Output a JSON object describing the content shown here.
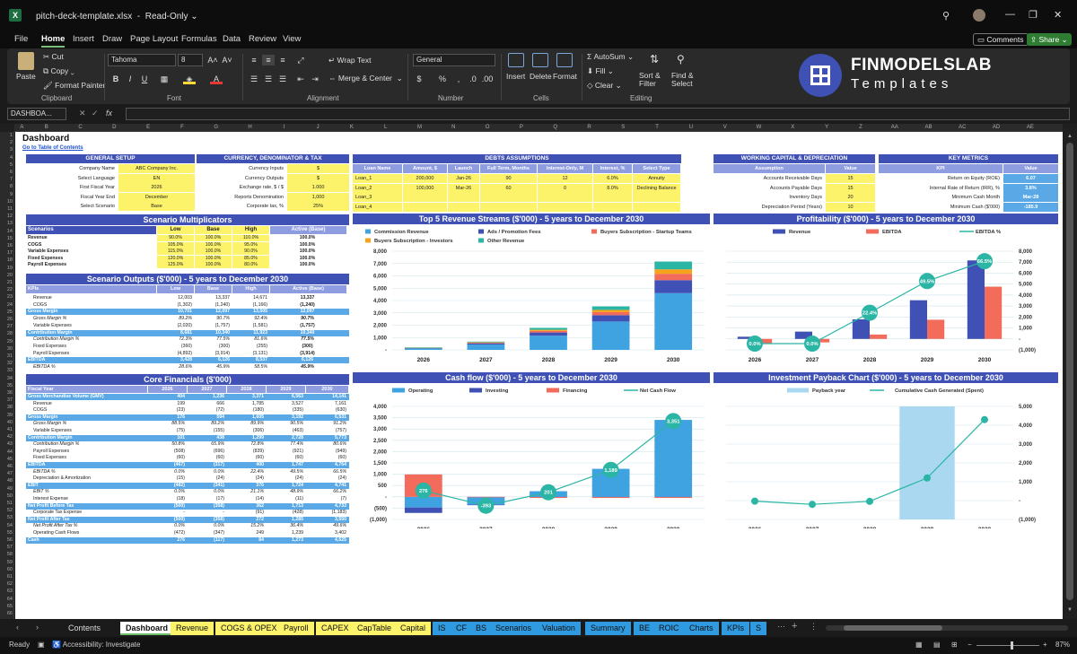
{
  "app": {
    "filename": "pitch-deck-template.xlsx",
    "mode": "Read-Only"
  },
  "menu": {
    "items": [
      "File",
      "Home",
      "Insert",
      "Draw",
      "Page Layout",
      "Formulas",
      "Data",
      "Review",
      "View"
    ],
    "active": "Home",
    "comments": "Comments",
    "share": "Share"
  },
  "ribbon": {
    "paste": "Paste",
    "cut": "Cut",
    "copy": "Copy",
    "format_painter": "Format Painter",
    "clipboard": "Clipboard",
    "font_name": "Tahoma",
    "font_size": "8",
    "font_group": "Font",
    "wrap_text": "Wrap Text",
    "merge_center": "Merge & Center",
    "alignment": "Alignment",
    "number_format": "General",
    "number_group": "Number",
    "insert": "Insert",
    "delete": "Delete",
    "format": "Format",
    "cells": "Cells",
    "autosum": "AutoSum",
    "fill": "Fill",
    "clear": "Clear",
    "sort_filter": "Sort & Filter",
    "find_select": "Find & Select",
    "editing": "Editing"
  },
  "brand": {
    "name": "FINMODELSLAB",
    "tagline": "Templates",
    "accent": "#3f51b5"
  },
  "formula_bar": {
    "namebox": "DASHBOA...",
    "fx": "fx"
  },
  "columns": [
    "A",
    "B",
    "C",
    "D",
    "E",
    "F",
    "G",
    "H",
    "I",
    "J",
    "K",
    "L",
    "M",
    "N",
    "O",
    "P",
    "Q",
    "R",
    "S",
    "T",
    "U",
    "V",
    "W",
    "X",
    "Y",
    "Z",
    "AA",
    "AB",
    "AC",
    "AD",
    "AE"
  ],
  "sheet": {
    "title": "Dashboard",
    "toc_link": "Go to Table of Contents",
    "general": {
      "title": "GENERAL SETUP",
      "rows": [
        [
          "Company Name",
          "ABC Company Inc."
        ],
        [
          "Select Language",
          "EN"
        ],
        [
          "First Fiscal Year",
          "2026"
        ],
        [
          "Fiscal Year End",
          "December"
        ],
        [
          "Select Scenario",
          "Base"
        ]
      ]
    },
    "currency": {
      "title": "CURRENCY, DENOMINATOR & TAX",
      "rows": [
        [
          "Currency Inputs",
          "$"
        ],
        [
          "Currency Outputs",
          "$"
        ],
        [
          "Exchange rate, $ / $",
          "1.000"
        ],
        [
          "Reports Denomination",
          "1,000"
        ],
        [
          "Corporate tax, %",
          "25%"
        ]
      ]
    },
    "debts": {
      "title": "DEBTS ASSUMPTIONS",
      "headers": [
        "Loan Name",
        "Amount, $",
        "Launch",
        "Full Term, Months",
        "Interest-Only, M",
        "Interest, %",
        "Select Type"
      ],
      "rows": [
        [
          "Loan_1",
          "200,000",
          "Jan-26",
          "90",
          "12",
          "6.0%",
          "Annuity"
        ],
        [
          "Loan_2",
          "100,000",
          "Mar-26",
          "60",
          "0",
          "8.0%",
          "Declining Balance"
        ],
        [
          "Loan_3",
          "",
          "",
          "",
          "",
          "",
          ""
        ],
        [
          "Loan_4",
          "",
          "",
          "",
          "",
          "",
          ""
        ]
      ]
    },
    "working": {
      "title": "WORKING CAPITAL & DEPRECIATION",
      "headers": [
        "Assumption",
        "Value"
      ],
      "rows": [
        [
          "Accounts Receivable Days",
          "15"
        ],
        [
          "Accounts Payable Days",
          "15"
        ],
        [
          "Inventory Days",
          "20"
        ],
        [
          "Depreciation Period (Years)",
          "10"
        ]
      ]
    },
    "kpis": {
      "title": "KEY METRICS",
      "headers": [
        "KPI",
        "Value"
      ],
      "rows": [
        [
          "Return on Equity (ROE)",
          "6.07"
        ],
        [
          "Internal Rate of Return (IRR), %",
          "3.8%"
        ],
        [
          "Minimum Cash Month",
          "Mar-28"
        ],
        [
          "Minimum Cash ($'000)",
          "-185.9"
        ]
      ]
    },
    "multipliers": {
      "title": "Scenario Multiplicators",
      "headers": [
        "Scenarios",
        "Low",
        "Base",
        "High",
        "Active (Base)"
      ],
      "rows": [
        [
          "Revenue",
          "90.0%",
          "100.0%",
          "110.0%",
          "100.0%"
        ],
        [
          "COGS",
          "105.0%",
          "100.0%",
          "95.0%",
          "100.0%"
        ],
        [
          "Variable Expenses",
          "115.0%",
          "100.0%",
          "90.0%",
          "100.0%"
        ],
        [
          "Fixed Expenses",
          "120.0%",
          "100.0%",
          "85.0%",
          "100.0%"
        ],
        [
          "Payroll Expenses",
          "125.0%",
          "100.0%",
          "80.0%",
          "100.0%"
        ]
      ]
    },
    "scen_out": {
      "title": "Scenario Outputs ($'000) - 5 years to December 2030",
      "headers": [
        "KPIs",
        "Low",
        "Base",
        "High",
        "Active (Base)"
      ],
      "rows": [
        [
          "Revenue",
          "12,003",
          "13,337",
          "14,671",
          "13,337",
          "n"
        ],
        [
          "COGS",
          "(1,302)",
          "(1,240)",
          "(1,166)",
          "(1,240)",
          "n"
        ],
        [
          "Gross Margin",
          "10,701",
          "12,097",
          "13,505",
          "12,097",
          "b"
        ],
        [
          "Gross Margin %",
          "89.2%",
          "90.7%",
          "92.4%",
          "90.7%",
          "i"
        ],
        [
          "Variable Expenses",
          "(2,020)",
          "(1,757)",
          "(1,581)",
          "(1,757)",
          "n"
        ],
        [
          "Contribution Margin",
          "8,681",
          "10,340",
          "11,923",
          "10,340",
          "b"
        ],
        [
          "Contribution Margin %",
          "72.3%",
          "77.5%",
          "81.6%",
          "77.5%",
          "i"
        ],
        [
          "Fixed Expenses",
          "(360)",
          "(300)",
          "(255)",
          "(300)",
          "n"
        ],
        [
          "Payroll Expenses",
          "(4,892)",
          "(3,914)",
          "(3,131)",
          "(3,914)",
          "n"
        ],
        [
          "EBITDA",
          "3,428",
          "6,126",
          "8,537",
          "6,126",
          "b"
        ],
        [
          "EBITDA %",
          "28.6%",
          "45.9%",
          "58.5%",
          "45.9%",
          "i"
        ]
      ]
    },
    "core": {
      "title": "Core Financials ($'000)",
      "headers": [
        "Fiscal Year",
        "2026",
        "2027",
        "2028",
        "2029",
        "2030"
      ],
      "rows": [
        [
          "Gross Merchandise Volume (GMV)",
          "404",
          "1,236",
          "3,371",
          "6,563",
          "14,141",
          "b"
        ],
        [
          "Revenue",
          "199",
          "666",
          "1,785",
          "3,527",
          "7,161",
          "n"
        ],
        [
          "COGS",
          "(23)",
          "(72)",
          "(180)",
          "(335)",
          "(630)",
          "n"
        ],
        [
          "Gross Margin",
          "176",
          "594",
          "1,605",
          "3,192",
          "6,531",
          "b"
        ],
        [
          "Gross Margin %",
          "88.5%",
          "89.2%",
          "89.9%",
          "90.5%",
          "91.2%",
          "i"
        ],
        [
          "Variable Expenses",
          "(75)",
          "(155)",
          "(306)",
          "(463)",
          "(757)",
          "n"
        ],
        [
          "Contribution Margin",
          "101",
          "438",
          "1,299",
          "2,728",
          "5,773",
          "b"
        ],
        [
          "Contribution Margin %",
          "50.8%",
          "65.9%",
          "72.8%",
          "77.4%",
          "80.6%",
          "i"
        ],
        [
          "Payroll Expenses",
          "(508)",
          "(696)",
          "(839)",
          "(921)",
          "(949)",
          "n"
        ],
        [
          "Fixed Expenses",
          "(60)",
          "(60)",
          "(60)",
          "(60)",
          "(60)",
          "n"
        ],
        [
          "EBITDA",
          "(467)",
          "(317)",
          "400",
          "1,747",
          "4,764",
          "b"
        ],
        [
          "EBITDA %",
          "0.0%",
          "0.0%",
          "22.4%",
          "49.5%",
          "66.5%",
          "i"
        ],
        [
          "Depreciation & Amortization",
          "(15)",
          "(24)",
          "(24)",
          "(24)",
          "(24)",
          "n"
        ],
        [
          "EBIT",
          "(482)",
          "(341)",
          "376",
          "1,724",
          "4,741",
          "b"
        ],
        [
          "EBIT %",
          "0.0%",
          "0.0%",
          "21.1%",
          "48.9%",
          "66.2%",
          "i"
        ],
        [
          "Interest Expense",
          "(18)",
          "(17)",
          "(14)",
          "(11)",
          "(7)",
          "n"
        ],
        [
          "Net Profit Before Tax",
          "(500)",
          "(358)",
          "362",
          "1,713",
          "4,733",
          "b"
        ],
        [
          "Corporate Tax Expense",
          "-",
          "-",
          "(91)",
          "(428)",
          "(1,183)",
          "n"
        ],
        [
          "Net Profit After Tax",
          "(500)",
          "(358)",
          "272",
          "1,285",
          "3,550",
          "b"
        ],
        [
          "Net Profit After Tax %",
          "0.0%",
          "0.0%",
          "15.2%",
          "36.4%",
          "49.6%",
          "i"
        ],
        [
          "Operating Cash Flows",
          "(472)",
          "(347)",
          "249",
          "1,239",
          "3,402",
          "n"
        ],
        [
          "Cash",
          "276",
          "(117)",
          "84",
          "1,273",
          "4,625",
          "b"
        ]
      ]
    }
  },
  "chart_data": [
    {
      "type": "bar",
      "title": "Top 5 Revenue Streams ($'000) - 5 years to December 2030",
      "categories": [
        "2026",
        "2027",
        "2028",
        "2029",
        "2030"
      ],
      "ylim": [
        0,
        8000
      ],
      "yticks": [
        "-",
        "1,000",
        "2,000",
        "3,000",
        "4,000",
        "5,000",
        "6,000",
        "7,000",
        "8,000"
      ],
      "series": [
        {
          "name": "Commission Revenue",
          "color": "#3ea3e0",
          "values": [
            130,
            430,
            1150,
            2300,
            4600
          ]
        },
        {
          "name": "Ads / Promotion Fees",
          "color": "#3f51b5",
          "values": [
            30,
            100,
            260,
            510,
            1050
          ]
        },
        {
          "name": "Buyers Subscription - Startup Teams",
          "color": "#f26b5b",
          "values": [
            15,
            50,
            130,
            250,
            520
          ]
        },
        {
          "name": "Buyers Subscription - Investors",
          "color": "#f7a21b",
          "values": [
            10,
            35,
            90,
            180,
            360
          ]
        },
        {
          "name": "Other Revenue",
          "color": "#2bb5a5",
          "values": [
            14,
            51,
            155,
            287,
            631
          ]
        }
      ]
    },
    {
      "type": "bar",
      "title": "Profitability ($'000) - 5 years to December 2030",
      "categories": [
        "2026",
        "2027",
        "2028",
        "2029",
        "2030"
      ],
      "ylim": [
        -1000,
        8000
      ],
      "yticks": [
        "(1,000)",
        "-",
        "1,000",
        "2,000",
        "3,000",
        "4,000",
        "5,000",
        "6,000",
        "7,000",
        "8,000"
      ],
      "series": [
        {
          "name": "Revenue",
          "color": "#3f51b5",
          "values": [
            199,
            666,
            1785,
            3527,
            7161
          ]
        },
        {
          "name": "EBITDA",
          "color": "#f26b5b",
          "values": [
            -467,
            -317,
            400,
            1747,
            4764
          ]
        },
        {
          "name": "EBITDA %",
          "color": "#2bb5a5",
          "values": [
            0.0,
            0.0,
            22.4,
            49.5,
            66.5
          ],
          "labels": [
            "0.0%",
            "0.0%",
            "22.4%",
            "49.5%",
            "66.5%"
          ]
        }
      ]
    },
    {
      "type": "bar",
      "title": "Cash flow ($'000) - 5 years to December 2030",
      "categories": [
        "2026",
        "2027",
        "2028",
        "2029",
        "2030"
      ],
      "ylim": [
        -1000,
        4000
      ],
      "yticks": [
        "(1,000)",
        "(500)",
        "-",
        "500",
        "1,000",
        "1,500",
        "2,000",
        "2,500",
        "3,000",
        "3,500",
        "4,000"
      ],
      "series": [
        {
          "name": "Operating",
          "color": "#3ea3e0",
          "values": [
            -472,
            -347,
            249,
            1239,
            3402
          ]
        },
        {
          "name": "Investing",
          "color": "#3f51b5",
          "values": [
            -240,
            -10,
            -10,
            -10,
            -10
          ]
        },
        {
          "name": "Financing",
          "color": "#f26b5b",
          "values": [
            990,
            0,
            -40,
            -40,
            -40
          ]
        },
        {
          "name": "Net Cash Flow",
          "color": "#2bb5a5",
          "values": [
            276,
            -393,
            201,
            1189,
            3351
          ],
          "labels": [
            "276",
            "-393",
            "201",
            "1,189",
            "3,351"
          ]
        }
      ]
    },
    {
      "type": "bar",
      "title": "Investment Payback Chart ($'000) - 5 years to December 2030",
      "categories": [
        "2026",
        "2027",
        "2028",
        "2029",
        "2030"
      ],
      "ylim": [
        -1000,
        5000
      ],
      "yticks": [
        "(1,000)",
        "-",
        "1,000",
        "2,000",
        "3,000",
        "4,000",
        "5,000"
      ],
      "series": [
        {
          "name": "Payback year",
          "color": "#a9d8f0",
          "values": [
            0,
            0,
            0,
            5000,
            0
          ]
        },
        {
          "name": "Cumulative Cash Generated (Spent)",
          "color": "#2bb5a5",
          "values": [
            -30,
            -200,
            -40,
            1200,
            4300
          ]
        }
      ]
    }
  ],
  "tabs": [
    {
      "label": "Contents",
      "style": "plain"
    },
    {
      "label": "Dashboard",
      "style": "active"
    },
    {
      "label": "Revenue",
      "style": "y"
    },
    {
      "label": "COGS & OPEX",
      "style": "y"
    },
    {
      "label": "Payroll",
      "style": "y"
    },
    {
      "label": "CAPEX",
      "style": "y"
    },
    {
      "label": "CapTable",
      "style": "y"
    },
    {
      "label": "Capital",
      "style": "y"
    },
    {
      "label": "IS",
      "style": "b"
    },
    {
      "label": "CF",
      "style": "b"
    },
    {
      "label": "BS",
      "style": "b"
    },
    {
      "label": "Scenarios",
      "style": "b"
    },
    {
      "label": "Valuation",
      "style": "b"
    },
    {
      "label": "Summary",
      "style": "b"
    },
    {
      "label": "BE",
      "style": "b"
    },
    {
      "label": "ROIC",
      "style": "b"
    },
    {
      "label": "Charts",
      "style": "b"
    },
    {
      "label": "KPIs",
      "style": "b"
    },
    {
      "label": "S",
      "style": "b"
    }
  ],
  "status": {
    "ready": "Ready",
    "accessibility": "Accessibility: Investigate",
    "zoom": "87%"
  }
}
